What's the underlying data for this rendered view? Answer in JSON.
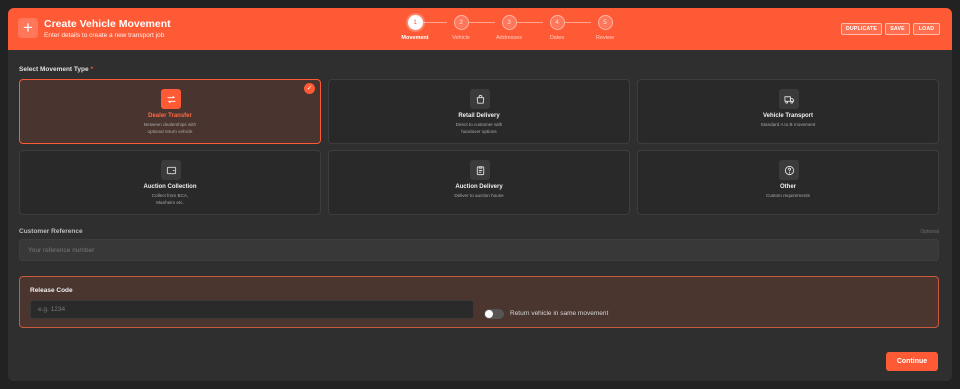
{
  "header": {
    "title": "Create Vehicle Movement",
    "subtitle": "Enter details to create a new transport job",
    "icon": "plus-icon",
    "buttons": {
      "duplicate": "DUPLICATE",
      "save": "SAVE",
      "load": "LOAD"
    }
  },
  "stepper": {
    "current_step": 1,
    "steps": [
      {
        "number": "1",
        "label": "Movement"
      },
      {
        "number": "2",
        "label": "Vehicle"
      },
      {
        "number": "3",
        "label": "Addresses"
      },
      {
        "number": "4",
        "label": "Dates"
      },
      {
        "number": "5",
        "label": "Review"
      }
    ]
  },
  "movement_type": {
    "label": "Select Movement Type",
    "required_mark": "*",
    "selected": "Dealer Transfer",
    "options": [
      {
        "title": "Dealer Transfer",
        "line1": "Between dealerships with",
        "line2": "optional return vehicle",
        "icon": "swap-arrows-icon"
      },
      {
        "title": "Retail Delivery",
        "line1": "Direct to customer with",
        "line2": "handover options",
        "icon": "shopping-bag-icon"
      },
      {
        "title": "Vehicle Transport",
        "line1": "Standard A to B movement",
        "line2": "",
        "icon": "truck-icon"
      },
      {
        "title": "Auction Collection",
        "line1": "Collect from BCA,",
        "line2": "Manheim etc.",
        "icon": "wallet-icon"
      },
      {
        "title": "Auction Delivery",
        "line1": "Deliver to auction house",
        "line2": "",
        "icon": "clipboard-icon"
      },
      {
        "title": "Other",
        "line1": "Custom requirements",
        "line2": "",
        "icon": "help-circle-icon"
      }
    ]
  },
  "customer_reference": {
    "label": "Customer Reference",
    "optional": "Optional",
    "placeholder": "Your reference number",
    "value": ""
  },
  "release_code": {
    "label": "Release Code",
    "placeholder": "e.g. 1234",
    "value": "",
    "toggle_label": "Return vehicle in same movement",
    "toggle_on": false
  },
  "footer": {
    "continue_label": "Continue"
  },
  "colors": {
    "accent": "#ff5a36",
    "panel": "#2f2f2f",
    "background": "#222222"
  }
}
